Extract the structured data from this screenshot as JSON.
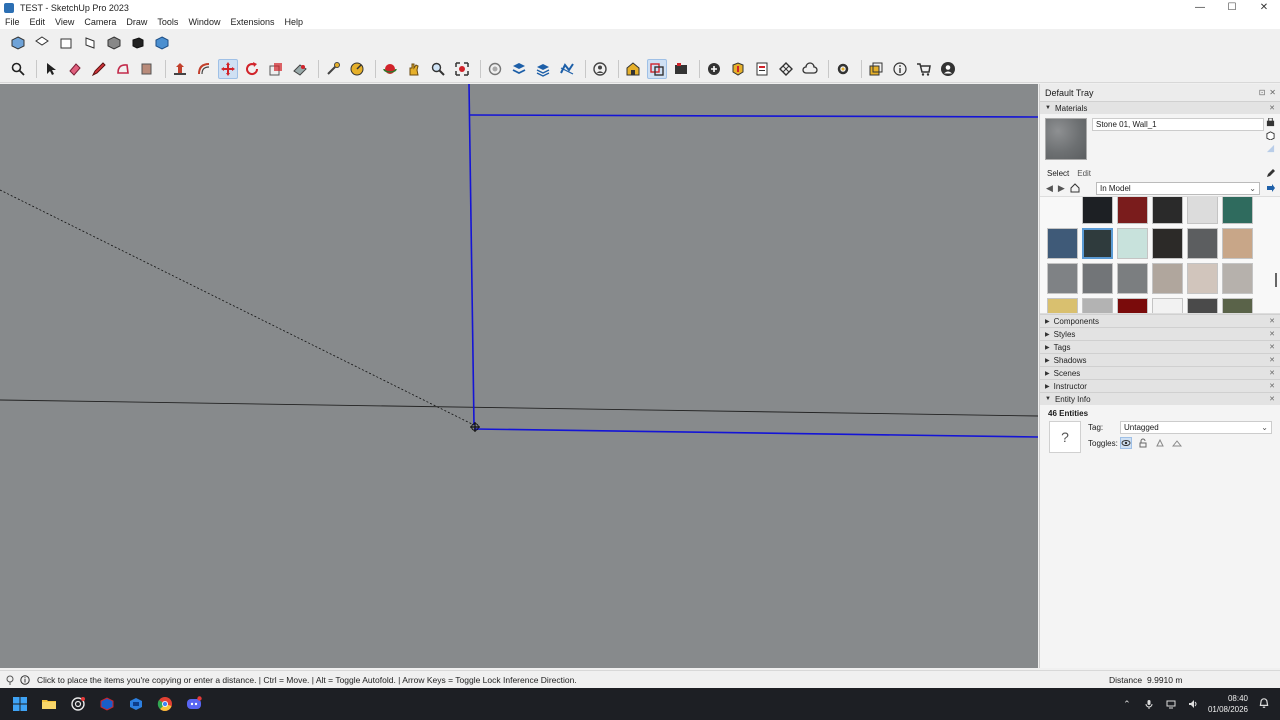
{
  "window": {
    "title": "TEST - SketchUp Pro 2023",
    "controls": {
      "minimize": "—",
      "maximize": "☐",
      "close": "✕"
    }
  },
  "menu": [
    "File",
    "Edit",
    "View",
    "Camera",
    "Draw",
    "Tools",
    "Window",
    "Extensions",
    "Help"
  ],
  "toolbar1_icons": [
    "iso-view-icon",
    "top-view-icon",
    "front-view-icon",
    "right-view-icon",
    "back-view-icon",
    "left-view-icon",
    "bottom-view-icon"
  ],
  "toolbar2_icons": [
    "search-icon",
    "select-icon",
    "eraser-icon",
    "pencil-icon",
    "shape-icon",
    "paint-bucket-icon",
    "push-pull-icon",
    "offset-icon",
    "move-icon",
    "rotate-icon",
    "scale-icon",
    "follow-me-icon",
    "tape-measure-icon",
    "protractor-icon",
    "orbit-icon",
    "pan-icon",
    "zoom-icon",
    "zoom-extents-icon",
    "section-icon",
    "layers-icon",
    "stack-icon",
    "sandbox-icon",
    "user-icon",
    "warehouse-icon",
    "solid-tools-icon",
    "camera-icon",
    "add-location-icon",
    "extension-icon",
    "report-icon",
    "texture-icon",
    "cloud-icon",
    "settings-icon",
    "outliner-icon",
    "info-icon",
    "cart-icon",
    "account-icon"
  ],
  "tray": {
    "title": "Default Tray",
    "materials": {
      "header": "Materials",
      "current_name": "Stone 01, Wall_1",
      "tab_select": "Select",
      "tab_edit": "Edit",
      "collection": "In Model",
      "swatches": [
        "#1d2024",
        "#7a1c1c",
        "#2a2a2a",
        "#dcdcdc",
        "#2f6b5e",
        "#3f5a78",
        "#2f3b3d",
        "#c8e2dc",
        "#2c2a28",
        "#5c5e60",
        "#c8a688",
        "#7f8285",
        "#727578",
        "#7b7e80",
        "#b0a69d",
        "#d1c5bc",
        "#b6b1ac",
        "#d9c06f",
        "#b3b3b3",
        "#7a0b0b",
        "#f2f2f2",
        "#4a4a4a",
        "#5a6349"
      ],
      "selected_index": 6
    },
    "panels": [
      "Components",
      "Styles",
      "Tags",
      "Shadows",
      "Scenes",
      "Instructor"
    ],
    "entity_info": {
      "header": "Entity Info",
      "count": "46 Entities",
      "tag_label": "Tag:",
      "tag_value": "Untagged",
      "toggles_label": "Toggles:"
    }
  },
  "status": {
    "message": "Click to place the items you're copying or enter a distance. | Ctrl = Move. | Alt = Toggle Autofold. | Arrow Keys = Toggle Lock Inference Direction.",
    "distance_label": "Distance",
    "distance_value": "9.9910 m"
  },
  "taskbar": {
    "apps": [
      "windows-start-icon",
      "file-explorer-icon",
      "chatgpt-icon",
      "sketchup-icon",
      "sketchup-layout-icon",
      "chrome-icon",
      "discord-icon"
    ],
    "time": "08:40",
    "date": "01/08/2026"
  },
  "colors": {
    "viewport": "#878a8c",
    "selection": "#1414d6",
    "accent": "#5b9bd5"
  }
}
